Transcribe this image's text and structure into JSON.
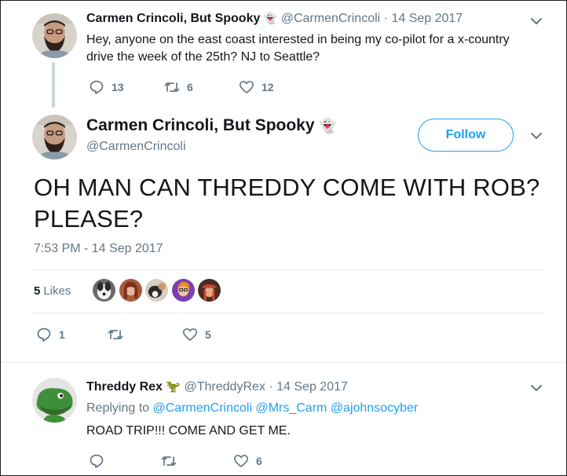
{
  "parent_tweet": {
    "display_name": "Carmen Crincoli, But Spooky",
    "name_emoji": "👻",
    "handle": "@CarmenCrincoli",
    "separator": "·",
    "date": "14 Sep 2017",
    "text": "Hey, anyone on the east coast interested in being my co-pilot for a x-country drive the week of the 25th? NJ to Seattle?",
    "replies": "13",
    "retweets": "6",
    "likes": "12"
  },
  "main_tweet": {
    "display_name": "Carmen Crincoli, But Spooky",
    "name_emoji": "👻",
    "handle": "@CarmenCrincoli",
    "follow_label": "Follow",
    "text": "OH MAN CAN THREDDY COME WITH ROB? PLEASE?",
    "timestamp": "7:53 PM - 14 Sep 2017",
    "likes_count": "5",
    "likes_label": "Likes",
    "replies": "1",
    "retweets": "",
    "likes": "5"
  },
  "reply_tweet": {
    "display_name": "Threddy Rex",
    "name_emoji": "🦖",
    "handle": "@ThreddyRex",
    "separator": "·",
    "date": "14 Sep 2017",
    "replying_to_label": "Replying to",
    "mentions": [
      "@CarmenCrincoli",
      "@Mrs_Carm",
      "@ajohnsocyber"
    ],
    "text": "ROAD TRIP!!! COME AND GET ME.",
    "replies": "",
    "retweets": "",
    "likes": "6"
  },
  "colors": {
    "accent": "#1da1f2",
    "secondary_text": "#657786",
    "divider": "#e6ecf0",
    "thread_line": "#ccd6dd"
  }
}
